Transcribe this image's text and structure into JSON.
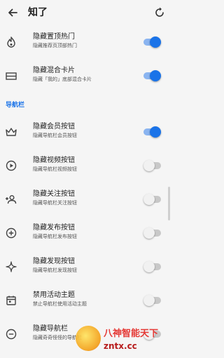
{
  "header": {
    "title": "知了"
  },
  "rows_top": [
    {
      "title": "隐藏置顶热门",
      "subtitle": "隐藏推荐页顶部热门",
      "icon": "flame-icon",
      "enabled": true
    },
    {
      "title": "隐藏混合卡片",
      "subtitle": "隐藏「我的」底部混合卡片",
      "icon": "card-icon",
      "enabled": true
    }
  ],
  "section": {
    "label": "导航栏"
  },
  "rows_nav": [
    {
      "title": "隐藏会员按钮",
      "subtitle": "隐藏导航栏会员按钮",
      "icon": "crown-icon",
      "enabled": true
    },
    {
      "title": "隐藏视频按钮",
      "subtitle": "隐藏导航栏视频按钮",
      "icon": "play-circle-icon",
      "enabled": false
    },
    {
      "title": "隐藏关注按钮",
      "subtitle": "隐藏导航栏关注按钮",
      "icon": "person-add-icon",
      "enabled": false
    },
    {
      "title": "隐藏发布按钮",
      "subtitle": "隐藏导航栏发布按钮",
      "icon": "plus-circle-icon",
      "enabled": false
    },
    {
      "title": "隐藏发现按钮",
      "subtitle": "隐藏导航栏发现按钮",
      "icon": "sparkle-icon",
      "enabled": false
    },
    {
      "title": "禁用活动主题",
      "subtitle": "禁止导航栏使用活动主题",
      "icon": "calendar-icon",
      "enabled": false
    },
    {
      "title": "隐藏导航栏",
      "subtitle": "隐藏奇奇怪怪的导航栏",
      "icon": "minus-circle-icon",
      "enabled": false
    }
  ],
  "watermark": {
    "line1": "八神智能天下",
    "line2": "zntx.cc"
  },
  "colors": {
    "accent": "#1a73e8",
    "background": "#f5f5f5"
  }
}
